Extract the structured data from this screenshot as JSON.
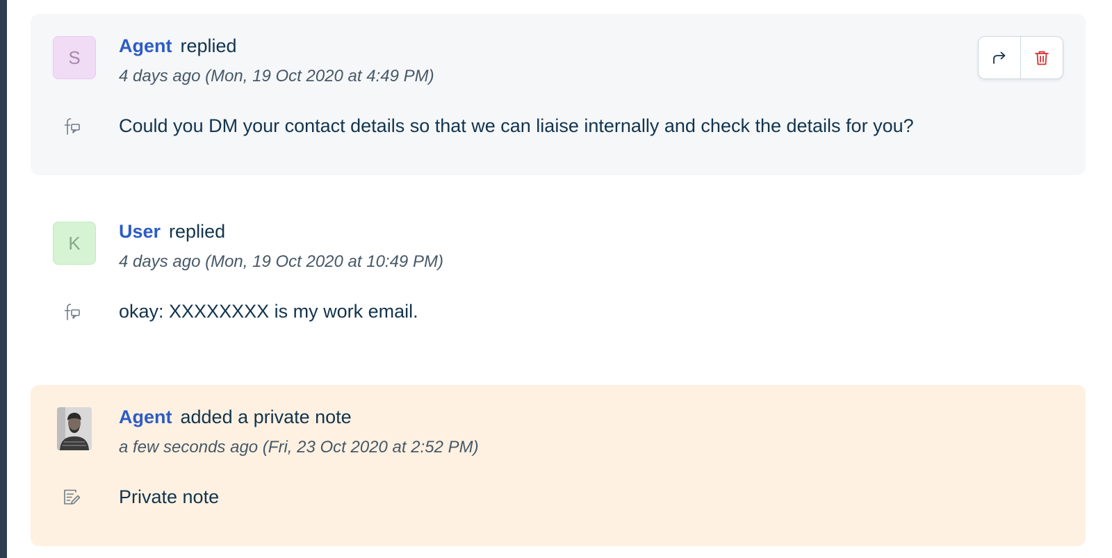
{
  "conversation": {
    "entries": [
      {
        "author": "Agent",
        "action": "replied",
        "timestamp": "4 days ago (Mon, 19 Oct 2020 at 4:49 PM)",
        "body": "Could you DM your contact details so that we can liaise internally and check the details for you?",
        "avatar_initial": "S",
        "source_icon": "facebook-message-icon",
        "actions": {
          "forward_icon": "forward-icon",
          "delete_icon": "trash-icon"
        }
      },
      {
        "author": "User",
        "action": "replied",
        "timestamp": "4 days ago (Mon, 19 Oct 2020 at 10:49 PM)",
        "body": "okay: XXXXXXXX is my work email.",
        "avatar_initial": "K",
        "source_icon": "facebook-message-icon"
      },
      {
        "author": "Agent",
        "action": "added a private note",
        "timestamp": "a few seconds ago (Fri, 23 Oct 2020 at 2:52 PM)",
        "body": "Private note",
        "source_icon": "note-edit-icon"
      }
    ]
  },
  "colors": {
    "author_link": "#2c5cc5",
    "agent_reply_bg": "#f5f7f9",
    "private_note_bg": "#fef1e1",
    "delete_red": "#d72d30",
    "left_rail": "#2c3e50"
  }
}
